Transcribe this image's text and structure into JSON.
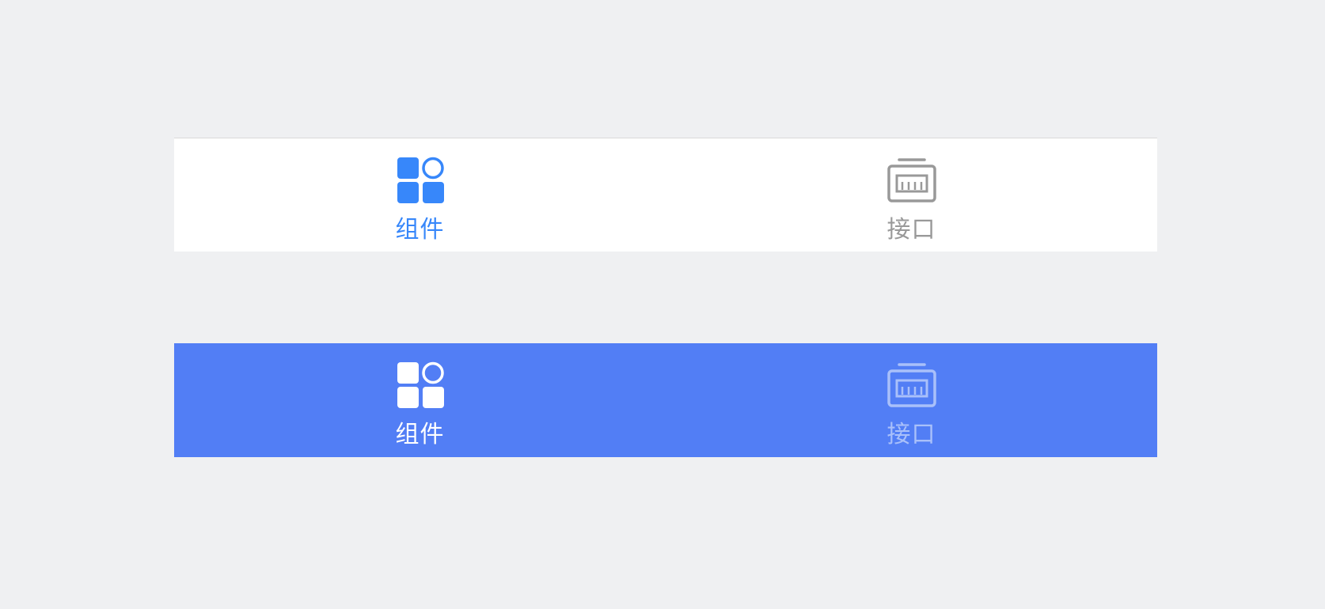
{
  "colors": {
    "page_background": "#eff0f2",
    "light_bar_background": "#ffffff",
    "dark_bar_background": "#527ef5",
    "light_active": "#3787fa",
    "light_inactive": "#999999",
    "dark_active": "#ffffff",
    "dark_inactive": "#a9c0fa"
  },
  "light_tabbar": {
    "tabs": [
      {
        "label": "组件",
        "icon": "components-grid-icon",
        "active": true
      },
      {
        "label": "接口",
        "icon": "api-interface-icon",
        "active": false
      }
    ]
  },
  "dark_tabbar": {
    "tabs": [
      {
        "label": "组件",
        "icon": "components-grid-icon",
        "active": true
      },
      {
        "label": "接口",
        "icon": "api-interface-icon",
        "active": false
      }
    ]
  }
}
